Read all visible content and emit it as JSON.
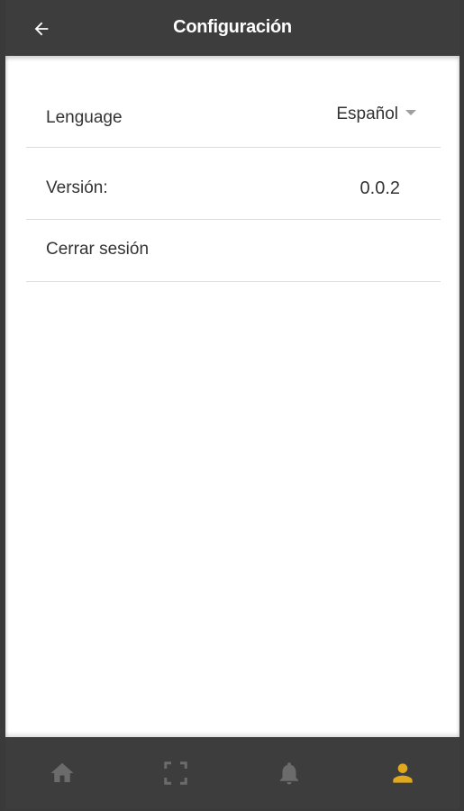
{
  "header": {
    "title": "Configuración",
    "back_icon": "arrow-left-icon"
  },
  "settings": {
    "language_label": "Lenguage",
    "language_value": "Español",
    "version_label": "Versión:",
    "version_value": "0.0.2",
    "logout_label": "Cerrar sesión"
  },
  "bottom_nav": {
    "items": [
      {
        "icon": "home-icon",
        "active": false
      },
      {
        "icon": "scan-icon",
        "active": false
      },
      {
        "icon": "bell-icon",
        "active": false
      },
      {
        "icon": "person-icon",
        "active": true
      }
    ],
    "active_color": "#e0a81e",
    "inactive_color": "#6b6b6b"
  },
  "colors": {
    "header_bg": "#3d3d3d",
    "content_bg": "#ffffff",
    "text": "#333333",
    "divider": "#dcdcdc"
  }
}
